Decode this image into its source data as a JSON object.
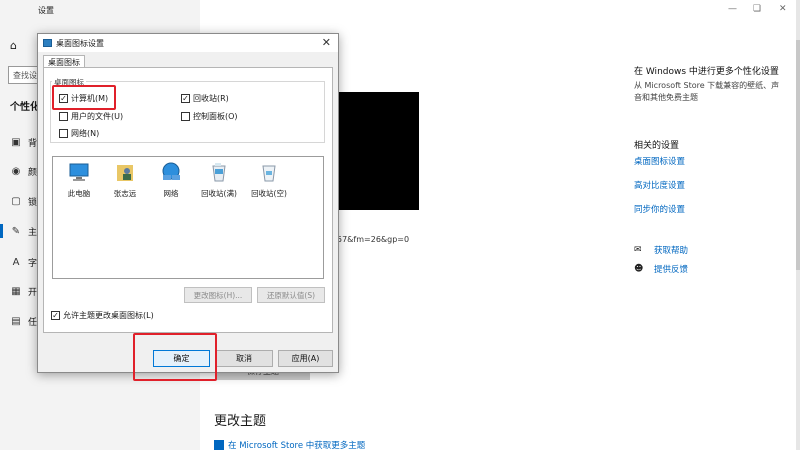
{
  "window": {
    "title": "设置",
    "minimize_icon": "minimize-icon",
    "maximize_icon": "maximize-icon",
    "close_icon": "close-icon"
  },
  "sidebar": {
    "search_placeholder": "查找设",
    "section_title": "个性化",
    "items": [
      {
        "icon": "picture-icon",
        "label": "背"
      },
      {
        "icon": "palette-icon",
        "label": "颜"
      },
      {
        "icon": "lock-screen-icon",
        "label": "锁"
      },
      {
        "icon": "theme-icon",
        "label": "主"
      },
      {
        "icon": "font-icon",
        "label": "字"
      },
      {
        "icon": "start-icon",
        "label": "开"
      },
      {
        "icon": "taskbar-icon",
        "label": "任"
      }
    ]
  },
  "main": {
    "url_fragment": "57&fm=26&gp=0",
    "save_theme_label": "保存主题",
    "change_theme_title": "更改主题",
    "store_link": "在 Microsoft Store 中获取更多主题"
  },
  "right_panel": {
    "title": "在 Windows 中进行更多个性化设置",
    "description": "从 Microsoft Store 下载兼容的壁纸、声音和其他免费主题",
    "related_title": "相关的设置",
    "links": [
      "桌面图标设置",
      "高对比度设置",
      "同步你的设置"
    ],
    "help": [
      {
        "icon": "help-chat-icon",
        "label": "获取帮助"
      },
      {
        "icon": "feedback-icon",
        "label": "提供反馈"
      }
    ]
  },
  "dialog": {
    "title": "桌面图标设置",
    "tab_label": "桌面图标",
    "group_label": "桌面图标",
    "checkboxes": [
      {
        "label": "计算机(M)",
        "checked": true
      },
      {
        "label": "回收站(R)",
        "checked": true
      },
      {
        "label": "用户的文件(U)",
        "checked": false
      },
      {
        "label": "控制面板(O)",
        "checked": false
      },
      {
        "label": "网络(N)",
        "checked": false
      }
    ],
    "icons": [
      {
        "label": "此电脑",
        "icon": "this-pc-icon"
      },
      {
        "label": "张志远",
        "icon": "user-folder-icon"
      },
      {
        "label": "网络",
        "icon": "network-icon"
      },
      {
        "label": "回收站(满)",
        "icon": "recycle-bin-full-icon"
      },
      {
        "label": "回收站(空)",
        "icon": "recycle-bin-empty-icon"
      }
    ],
    "change_icon_label": "更改图标(H)...",
    "restore_default_label": "还原默认值(S)",
    "allow_themes_label": "允许主题更改桌面图标(L)",
    "allow_themes_checked": true,
    "ok_label": "确定",
    "cancel_label": "取消",
    "apply_label": "应用(A)"
  }
}
